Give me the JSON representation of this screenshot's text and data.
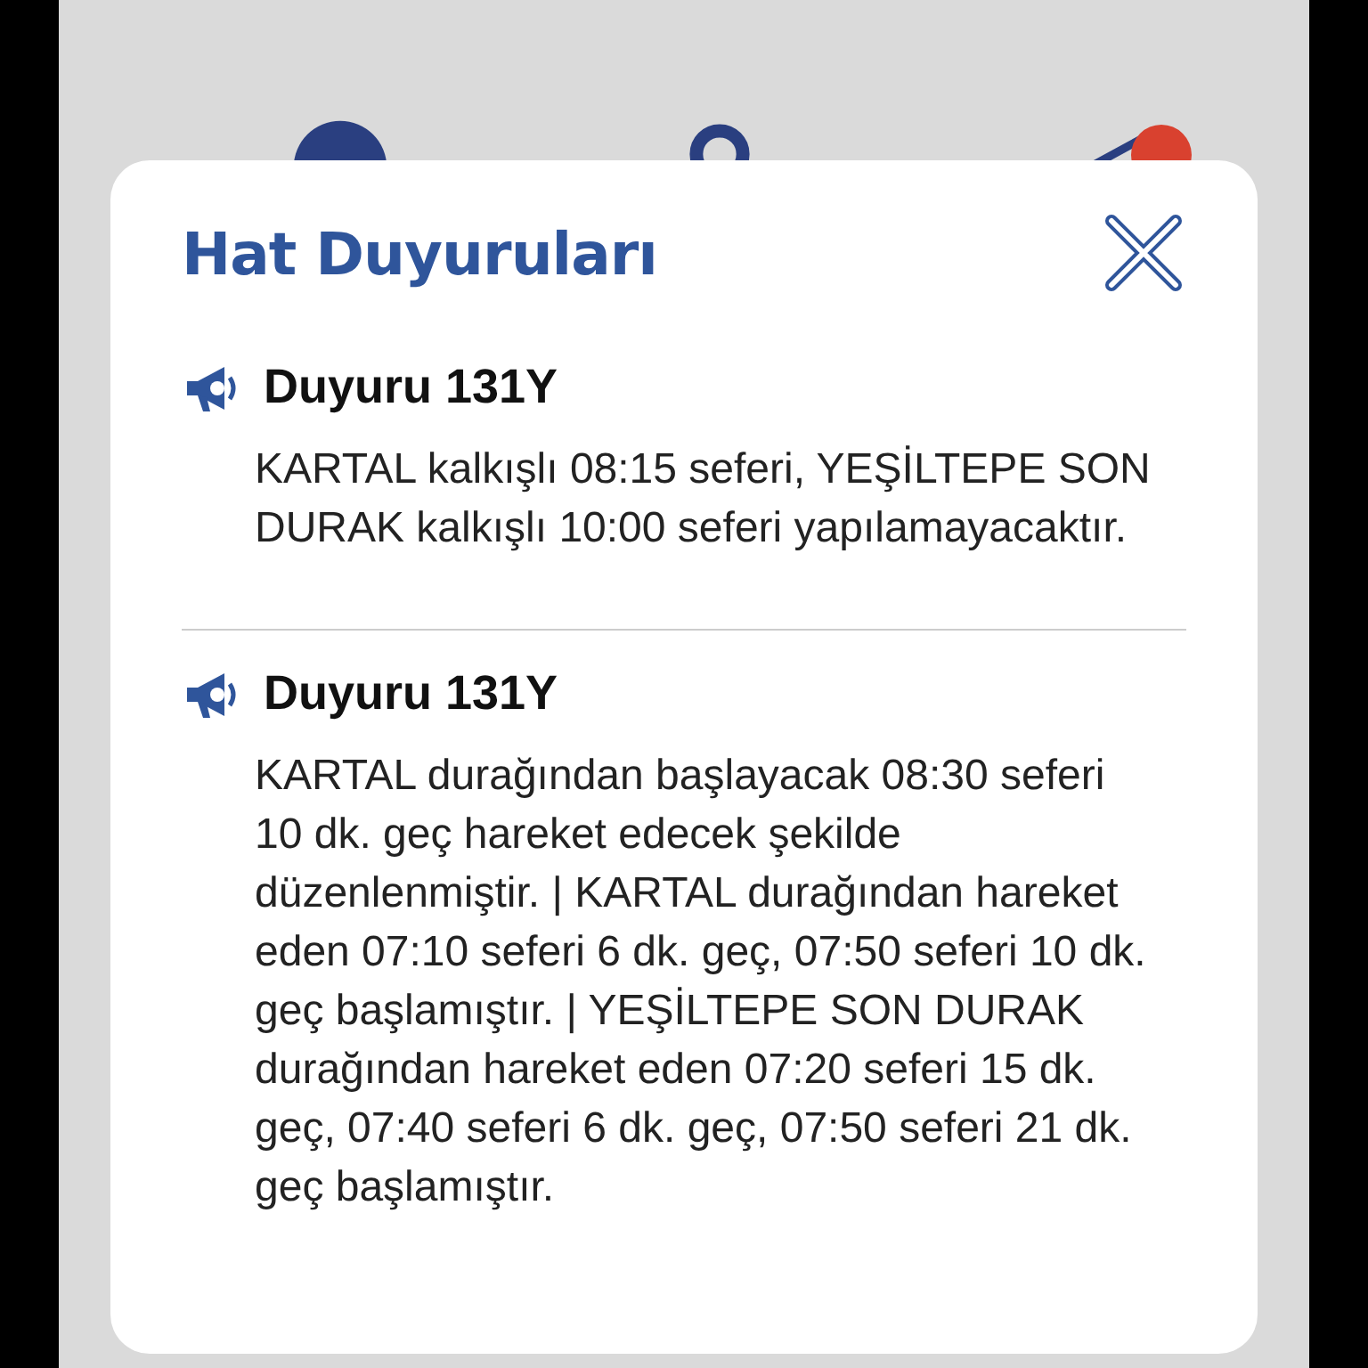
{
  "modal": {
    "title": "Hat Duyuruları",
    "announcements": [
      {
        "title": "Duyuru 131Y",
        "text": "KARTAL kalkışlı 08:15 seferi, YEŞİLTEPE SON DURAK kalkışlı 10:00 seferi yapılamayacaktır."
      },
      {
        "title": "Duyuru 131Y",
        "text": "KARTAL durağından başlayacak 08:30 seferi 10 dk. geç hareket edecek şekilde düzenlenmiştir. | KARTAL durağından hareket eden 07:10 seferi 6 dk. geç, 07:50 seferi 10 dk. geç başlamıştır. | YEŞİLTEPE SON DURAK durağından hareket eden 07:20 seferi 15 dk. geç, 07:40 seferi 6 dk. geç, 07:50 seferi 21 dk. geç başlamıştır."
      }
    ]
  }
}
